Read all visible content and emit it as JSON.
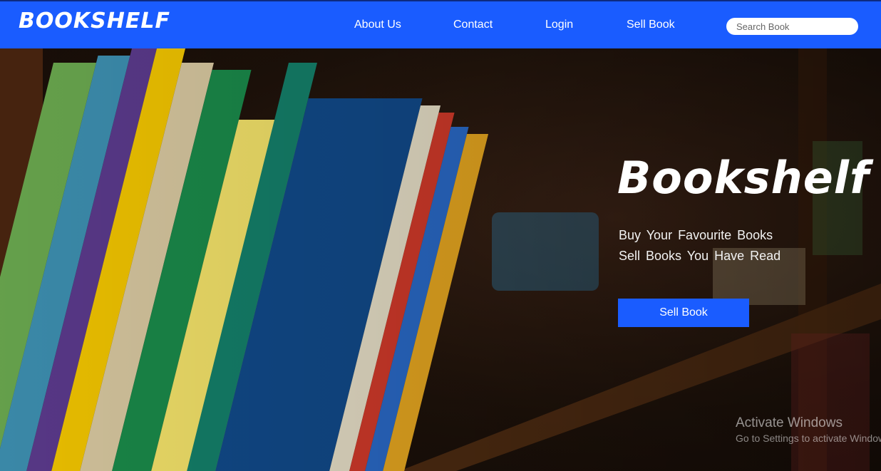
{
  "navbar": {
    "brand": "BOOKSHELF",
    "links": [
      {
        "label": "About Us"
      },
      {
        "label": "Contact"
      },
      {
        "label": "Login"
      },
      {
        "label": "Sell Book"
      }
    ],
    "search": {
      "placeholder": "Search Book",
      "value": ""
    }
  },
  "hero": {
    "title": "Bookshelf",
    "line1": "Buy Your Favourite Books",
    "line2": "Sell Books You Have Read",
    "button_label": "Sell Book"
  },
  "watermark": {
    "title": "Activate Windows",
    "subtitle": "Go to Settings to activate Windows."
  },
  "colors": {
    "accent": "#1a5cff",
    "text": "#ffffff"
  }
}
